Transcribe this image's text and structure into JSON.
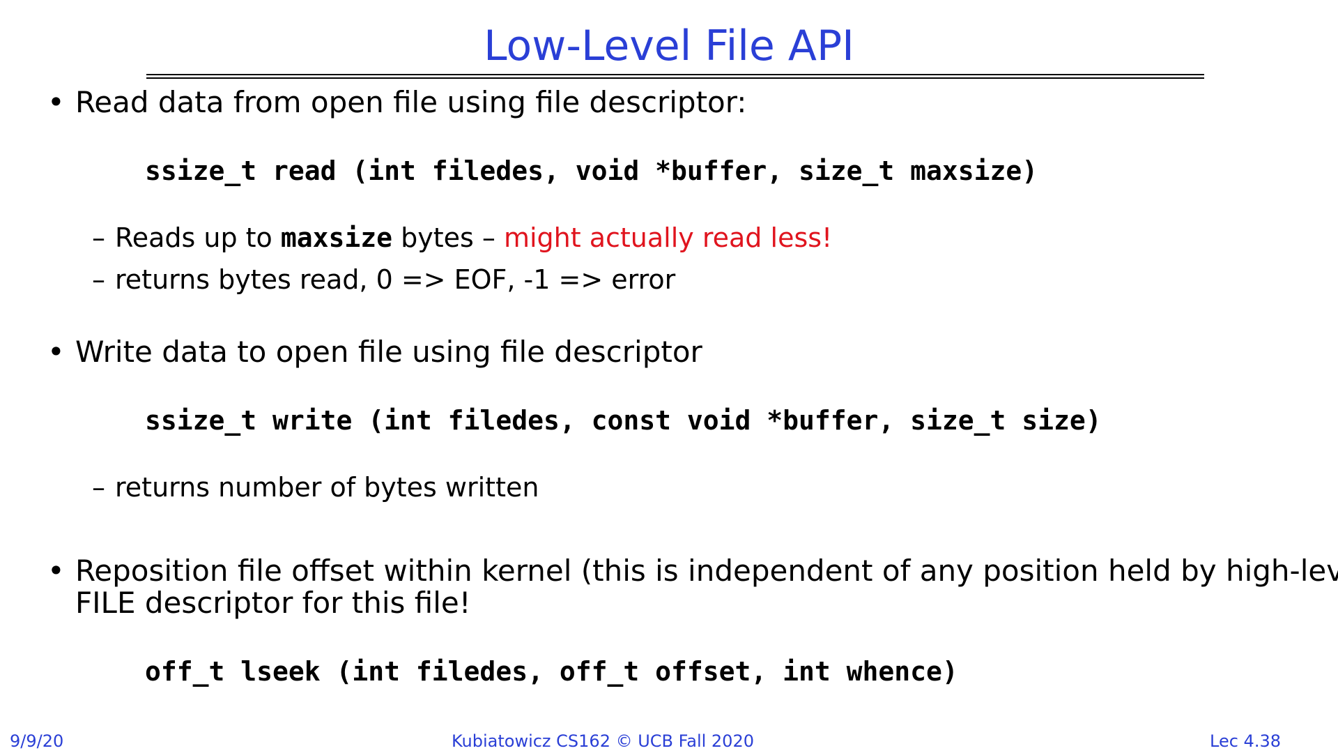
{
  "slide": {
    "title": "Low-Level File API"
  },
  "bullets": [
    {
      "marker": "•",
      "text": "Read data from open file using file descriptor:",
      "code": "ssize_t read (int filedes, void *buffer, size_t maxsize)",
      "subitems": [
        {
          "dash": "–",
          "pre": "Reads up to ",
          "code": "maxsize",
          "post": " bytes – ",
          "highlight": "might actually read less!"
        },
        {
          "dash": "–",
          "text": "returns bytes read, 0 => EOF, -1 => error"
        }
      ]
    },
    {
      "marker": "•",
      "text": "Write data to open file using file descriptor",
      "code": "ssize_t write (int filedes, const void *buffer, size_t size)",
      "subitems": [
        {
          "dash": "–",
          "text": "returns number of bytes written"
        }
      ]
    },
    {
      "marker": "•",
      "text_line1": "Reposition file offset within kernel (this is independent of any position held by high-level",
      "text_line2": "FILE descriptor for this file!",
      "code": "off_t lseek (int filedes, off_t offset, int whence)"
    }
  ],
  "footer": {
    "date": "9/9/20",
    "course": "Kubiatowicz CS162 © UCB Fall 2020",
    "lecture": "Lec 4.38"
  },
  "colors": {
    "title": "#2a3fd6",
    "highlight": "#e0141e",
    "footer": "#2a3fd6"
  }
}
